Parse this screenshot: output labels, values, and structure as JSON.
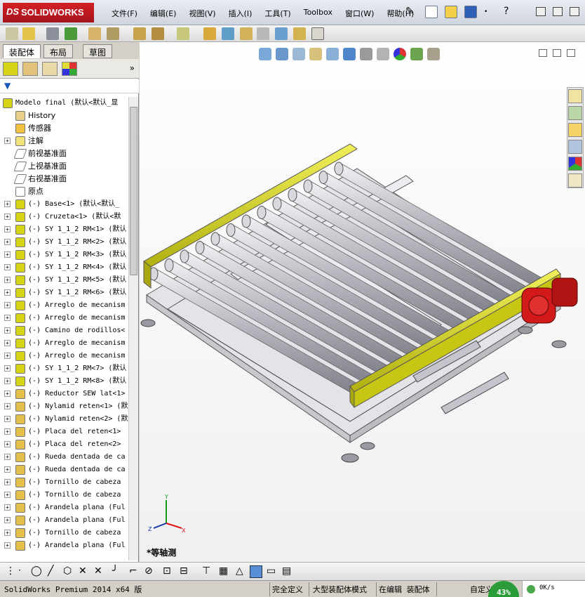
{
  "app": {
    "logo_ds": "DS",
    "logo_text": "SOLIDWORKS"
  },
  "menu": [
    "文件(F)",
    "编辑(E)",
    "视图(V)",
    "插入(I)",
    "工具(T)",
    "Toolbox",
    "窗口(W)",
    "帮助(H)"
  ],
  "panel": {
    "tabs": [
      "装配体",
      "布局",
      "草图"
    ],
    "expand_more": "»",
    "tree": [
      {
        "label": "Modelo final  (默认<默认_显",
        "type": "root"
      },
      {
        "label": "History",
        "type": "history"
      },
      {
        "label": "传感器",
        "type": "sensor"
      },
      {
        "label": "注解",
        "type": "note",
        "exp": true
      },
      {
        "label": "前视基准面",
        "type": "plane"
      },
      {
        "label": "上视基准面",
        "type": "plane"
      },
      {
        "label": "右视基准面",
        "type": "plane"
      },
      {
        "label": "原点",
        "type": "origin"
      },
      {
        "label": "(-) Base<1> (默认<默认_",
        "type": "asm",
        "exp": true
      },
      {
        "label": "(-) Cruzeta<1> (默认<默",
        "type": "asm",
        "exp": true
      },
      {
        "label": "(-) SY 1_1_2 RM<1> (默认",
        "type": "asm",
        "exp": true
      },
      {
        "label": "(-) SY 1_1_2 RM<2> (默认",
        "type": "asm",
        "exp": true
      },
      {
        "label": "(-) SY 1_1_2 RM<3> (默认",
        "type": "asm",
        "exp": true
      },
      {
        "label": "(-) SY 1_1_2 RM<4> (默认",
        "type": "asm",
        "exp": true
      },
      {
        "label": "(-) SY 1_1_2 RM<5> (默认",
        "type": "asm",
        "exp": true
      },
      {
        "label": "(-) SY 1_1_2 RM<6> (默认",
        "type": "asm",
        "exp": true
      },
      {
        "label": "(-) Arreglo de mecanism",
        "type": "asm",
        "exp": true
      },
      {
        "label": "(-) Arreglo de mecanism",
        "type": "asm",
        "exp": true
      },
      {
        "label": "(-) Camino de rodillos<",
        "type": "asm",
        "exp": true
      },
      {
        "label": "(-) Arreglo de mecanism",
        "type": "asm",
        "exp": true
      },
      {
        "label": "(-) Arreglo de mecanism",
        "type": "asm",
        "exp": true
      },
      {
        "label": "(-) SY 1_1_2 RM<7> (默认",
        "type": "asm",
        "exp": true
      },
      {
        "label": "(-) SY 1_1_2 RM<8> (默认",
        "type": "asm",
        "exp": true
      },
      {
        "label": "(-) Reductor SEW lat<1>",
        "type": "part",
        "exp": true
      },
      {
        "label": "(-) Nylamid reten<1> (默",
        "type": "part",
        "exp": true
      },
      {
        "label": "(-) Nylamid reten<2> (默",
        "type": "part",
        "exp": true
      },
      {
        "label": "(-) Placa del reten<1>",
        "type": "part",
        "exp": true
      },
      {
        "label": "(-) Placa del reten<2>",
        "type": "part",
        "exp": true
      },
      {
        "label": "(-) Rueda dentada de ca",
        "type": "part",
        "exp": true
      },
      {
        "label": "(-) Rueda dentada de ca",
        "type": "part",
        "exp": true
      },
      {
        "label": "(-) Tornillo de cabeza",
        "type": "part",
        "exp": true
      },
      {
        "label": "(-) Tornillo de cabeza",
        "type": "part",
        "exp": true
      },
      {
        "label": "(-) Arandela plana (Ful",
        "type": "part",
        "exp": true
      },
      {
        "label": "(-) Arandela plana (Ful",
        "type": "part",
        "exp": true
      },
      {
        "label": "(-) Tornillo de cabeza",
        "type": "part",
        "exp": true
      },
      {
        "label": "(-) Arandela plana (Ful",
        "type": "part",
        "exp": true
      }
    ]
  },
  "viewport": {
    "view_label": "*等轴测",
    "triad": {
      "x": "X",
      "y": "Y",
      "z": "Z"
    }
  },
  "status": {
    "product": "SolidWorks Premium 2014 x64 版",
    "fully_defined": "完全定义",
    "large_assembly": "大型装配体模式",
    "editing": "在编辑 装配体",
    "custom": "自定义",
    "percent": "43%",
    "speed": "0K/s"
  },
  "colors": {
    "frame_yellow": "#d6d418",
    "roller": "#b4b4bc",
    "motor_red": "#d21a1a",
    "steel": "#dcdce0"
  }
}
